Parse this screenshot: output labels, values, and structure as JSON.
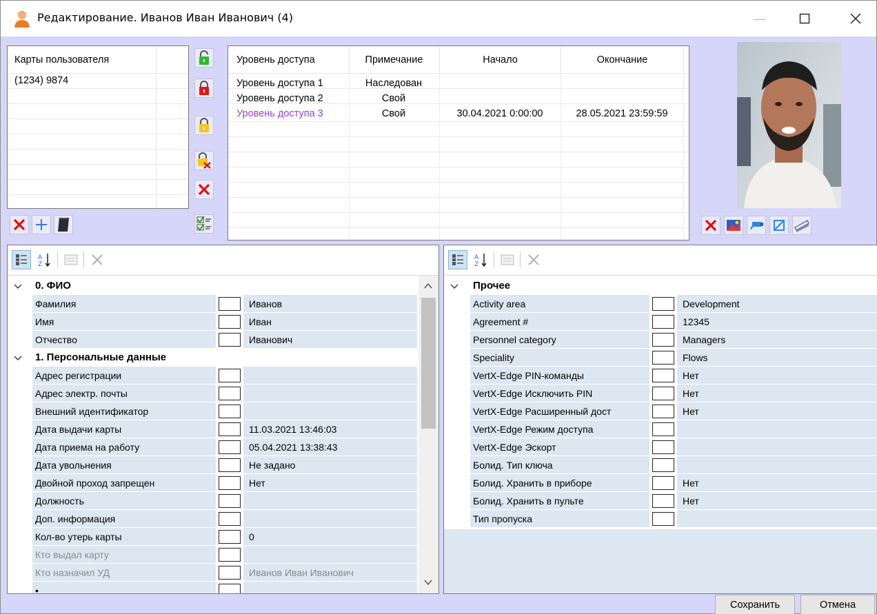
{
  "window": {
    "title": "Редактирование. Иванов Иван Иванович (4)"
  },
  "cards": {
    "header": "Карты пользователя",
    "items": [
      "(1234) 9874"
    ]
  },
  "access": {
    "columns": [
      "Уровень доступа",
      "Примечание",
      "Начало",
      "Окончание"
    ],
    "rows": [
      {
        "level": "Уровень доступа 1",
        "note": "Наследован",
        "start": "",
        "end": ""
      },
      {
        "level": "Уровень доступа 2",
        "note": "Свой",
        "start": "",
        "end": ""
      },
      {
        "level": "Уровень доступа 3",
        "note": "Свой",
        "start": "30.04.2021 0:00:00",
        "end": "28.05.2021 23:59:59"
      }
    ],
    "highlight_color": "#9b3fd1"
  },
  "left_grid": {
    "cat0": "0. ФИО",
    "cat1": "1. Персональные данные",
    "props": [
      {
        "name": "Фамилия",
        "value": "Иванов"
      },
      {
        "name": "Имя",
        "value": "Иван"
      },
      {
        "name": "Отчество",
        "value": "Иванович"
      }
    ],
    "props2": [
      {
        "name": "Адрес регистрации",
        "value": ""
      },
      {
        "name": "Адрес электр. почты",
        "value": ""
      },
      {
        "name": "Внешний идентификатор",
        "value": ""
      },
      {
        "name": "Дата выдачи карты",
        "value": "11.03.2021 13:46:03"
      },
      {
        "name": "Дата приема на работу",
        "value": "05.04.2021 13:38:43"
      },
      {
        "name": "Дата увольнения",
        "value": "Не задано"
      },
      {
        "name": "Двойной проход запрещен",
        "value": "Нет"
      },
      {
        "name": "Должность",
        "value": ""
      },
      {
        "name": "Доп. информация",
        "value": ""
      },
      {
        "name": "Кол-во утерь карты",
        "value": "0"
      },
      {
        "name": "Кто выдал карту",
        "value": ""
      },
      {
        "name": "Кто назначил УД",
        "value": "Иванов Иван Иванович"
      }
    ]
  },
  "right_grid": {
    "cat": "Прочее",
    "props": [
      {
        "name": "Activity area",
        "value": "Development"
      },
      {
        "name": "Agreement #",
        "value": "12345"
      },
      {
        "name": "Personnel category",
        "value": "Managers"
      },
      {
        "name": "Speciality",
        "value": "Flows"
      },
      {
        "name": "VertX-Edge PIN-команды",
        "value": "Нет"
      },
      {
        "name": "VertX-Edge Исключить PIN",
        "value": "Нет"
      },
      {
        "name": "VertX-Edge Расширенный дост",
        "value": "Нет"
      },
      {
        "name": "VertX-Edge Режим доступа",
        "value": ""
      },
      {
        "name": "VertX-Edge Эскорт",
        "value": ""
      },
      {
        "name": "Болид. Тип ключа",
        "value": ""
      },
      {
        "name": "Болид. Хранить в приборе",
        "value": "Нет"
      },
      {
        "name": "Болид. Хранить в пульте",
        "value": "Нет"
      },
      {
        "name": "Тип пропуска",
        "value": ""
      }
    ]
  },
  "footer": {
    "save": "Сохранить",
    "cancel": "Отмена"
  }
}
